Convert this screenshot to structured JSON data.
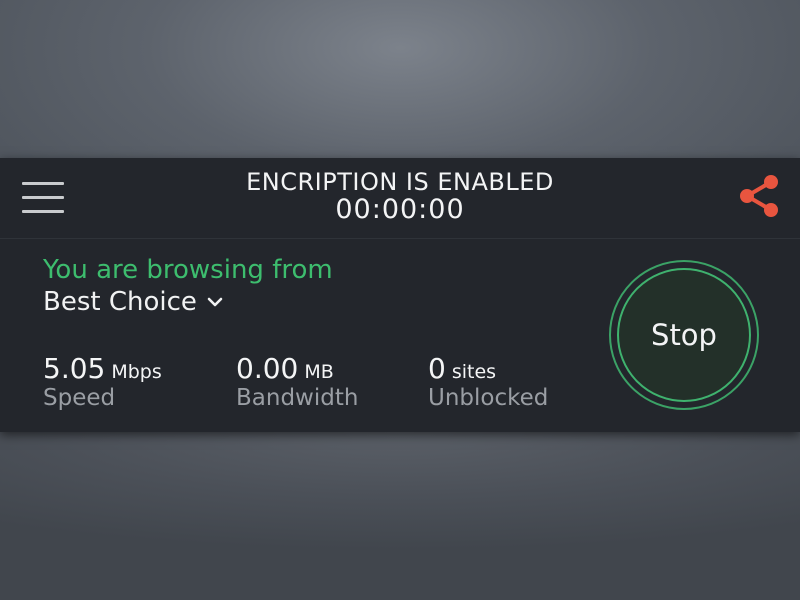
{
  "header": {
    "status_text": "ENCRIPTION IS ENABLED",
    "timer": "00:00:00",
    "menu_icon": "hamburger-menu-icon",
    "share_icon": "share-icon",
    "share_color": "#e8553f"
  },
  "connection": {
    "browsing_label": "You are browsing from",
    "location": "Best Choice",
    "location_icon": "chevron-down-icon",
    "accent_color": "#3dbd6e"
  },
  "stats": [
    {
      "value": "5.05",
      "unit": "Mbps",
      "label": "Speed"
    },
    {
      "value": "0.00",
      "unit": "MB",
      "label": "Bandwidth"
    },
    {
      "value": "0",
      "unit": "sites",
      "label": "Unblocked"
    }
  ],
  "stop_button": {
    "label": "Stop"
  }
}
